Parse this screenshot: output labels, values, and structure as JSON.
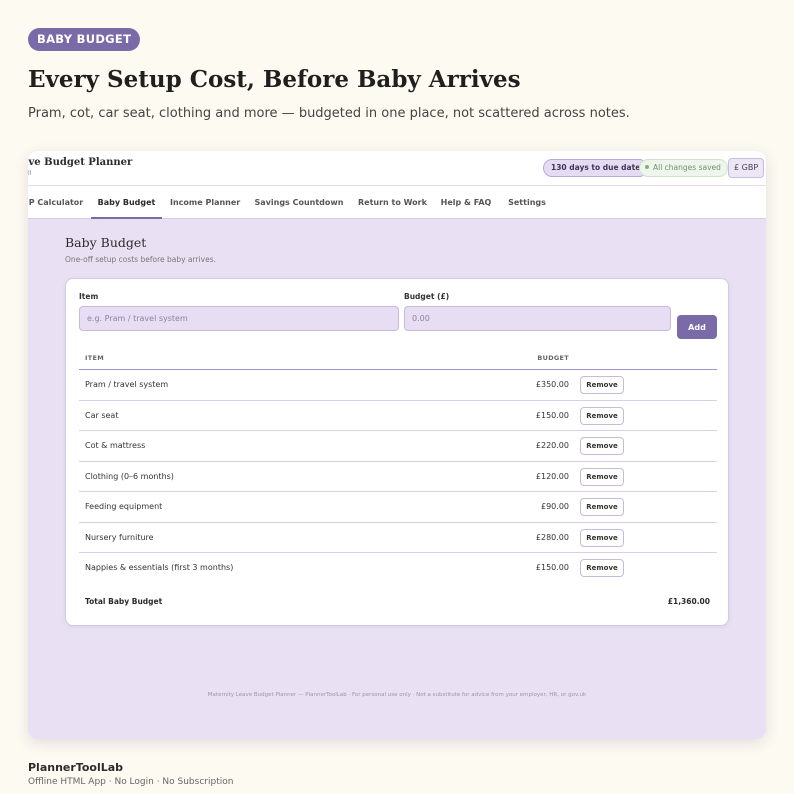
{
  "promo": {
    "badge": "BABY BUDGET",
    "title": "Every Setup Cost, Before Baby Arrives",
    "subtitle": "Pram, cot, car seat, clothing and more — budgeted in one place, not scattered across notes."
  },
  "app": {
    "title": "ave Budget Planner",
    "title_sub": "ll",
    "due_pill": "130 days to due date",
    "saved_pill": "All changes saved",
    "currency": "£ GBP",
    "tabs": [
      {
        "label": "P Calculator",
        "active": false
      },
      {
        "label": "Baby Budget",
        "active": true
      },
      {
        "label": "Income Planner",
        "active": false
      },
      {
        "label": "Savings Countdown",
        "active": false
      },
      {
        "label": "Return to Work",
        "active": false
      },
      {
        "label": "Help & FAQ",
        "active": false
      },
      {
        "label": "Settings",
        "active": false
      }
    ],
    "section": {
      "title": "Baby Budget",
      "subtitle": "One-off setup costs before baby arrives."
    },
    "form": {
      "item_label": "Item",
      "item_placeholder": "e.g. Pram / travel system",
      "budget_label": "Budget (£)",
      "budget_placeholder": "0.00",
      "add_label": "Add"
    },
    "table": {
      "headers": {
        "item": "ITEM",
        "budget": "BUDGET"
      },
      "rows": [
        {
          "item": "Pram / travel system",
          "budget": "£350.00",
          "action": "Remove"
        },
        {
          "item": "Car seat",
          "budget": "£150.00",
          "action": "Remove"
        },
        {
          "item": "Cot & mattress",
          "budget": "£220.00",
          "action": "Remove"
        },
        {
          "item": "Clothing (0–6 months)",
          "budget": "£120.00",
          "action": "Remove"
        },
        {
          "item": "Feeding equipment",
          "budget": "£90.00",
          "action": "Remove"
        },
        {
          "item": "Nursery furniture",
          "budget": "£280.00",
          "action": "Remove"
        },
        {
          "item": "Nappies & essentials (first 3 months)",
          "budget": "£150.00",
          "action": "Remove"
        }
      ],
      "total_label": "Total Baby Budget",
      "total_value": "£1,360.00"
    },
    "footer": "Maternity Leave Budget Planner — PlannerToolLab · For personal use only · Not a substitute for advice from your employer, HR, or gov.uk"
  },
  "brand": {
    "name": "PlannerToolLab",
    "tagline": "Offline HTML App  ·  No Login  ·  No Subscription"
  },
  "colors": {
    "accent": "#7b6aa8",
    "page_bg": "#fdfaf1",
    "app_bg": "#e9e1f3"
  }
}
